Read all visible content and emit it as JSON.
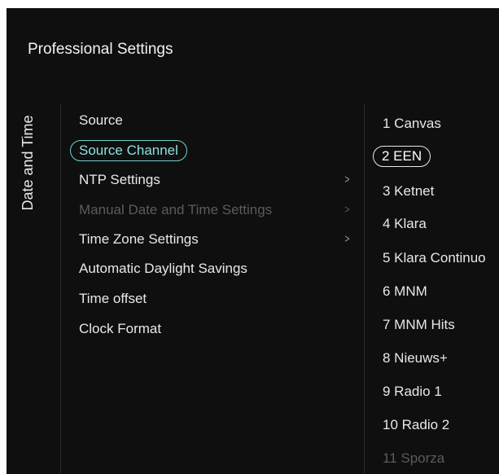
{
  "header": {
    "title": "Professional Settings"
  },
  "side_label": "Date and Time",
  "menu": {
    "items": [
      {
        "label": "Source",
        "has_submenu": false,
        "state": "normal"
      },
      {
        "label": "Source Channel",
        "has_submenu": false,
        "state": "selected"
      },
      {
        "label": "NTP Settings",
        "has_submenu": true,
        "state": "normal"
      },
      {
        "label": "Manual Date and Time Settings",
        "has_submenu": true,
        "state": "disabled"
      },
      {
        "label": "Time Zone Settings",
        "has_submenu": true,
        "state": "normal"
      },
      {
        "label": "Automatic Daylight Savings",
        "has_submenu": false,
        "state": "normal"
      },
      {
        "label": "Time offset",
        "has_submenu": false,
        "state": "normal"
      },
      {
        "label": "Clock Format",
        "has_submenu": false,
        "state": "normal"
      }
    ],
    "chevron_glyph": ">"
  },
  "channels": {
    "items": [
      {
        "label": "1 Canvas",
        "state": "normal"
      },
      {
        "label": "2 EEN",
        "state": "selected"
      },
      {
        "label": "3 Ketnet",
        "state": "normal"
      },
      {
        "label": "4 Klara",
        "state": "normal"
      },
      {
        "label": "5 Klara Continuo",
        "state": "normal"
      },
      {
        "label": "6 MNM",
        "state": "normal"
      },
      {
        "label": "7 MNM Hits",
        "state": "normal"
      },
      {
        "label": "8 Nieuws+",
        "state": "normal"
      },
      {
        "label": "9 Radio 1",
        "state": "normal"
      },
      {
        "label": "10 Radio 2",
        "state": "normal"
      },
      {
        "label": "11 Sporza",
        "state": "faded"
      }
    ]
  },
  "colors": {
    "background": "#0f0f0f",
    "text": "#e8e8e8",
    "accent": "#6fcfcf",
    "disabled": "#5b5b5b"
  }
}
